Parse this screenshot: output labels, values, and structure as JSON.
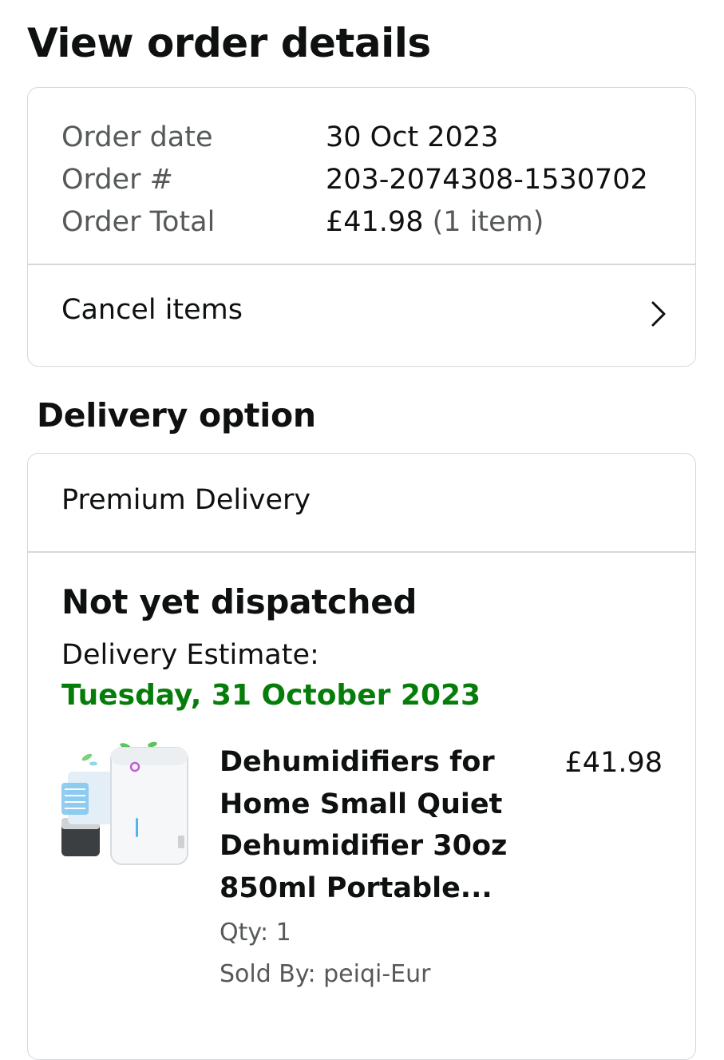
{
  "page": {
    "title": "View order details"
  },
  "order_summary": {
    "rows": [
      {
        "label": "Order date",
        "value": "30 Oct 2023"
      },
      {
        "label": "Order #",
        "value": "203-2074308-1530702"
      },
      {
        "label": "Order Total",
        "value": "£41.98",
        "extra": "(1 item)"
      }
    ],
    "cancel_label": "Cancel items"
  },
  "delivery": {
    "heading": "Delivery option",
    "option": "Premium Delivery",
    "status": "Not yet dispatched",
    "estimate_label": "Delivery Estimate:",
    "estimate_date": "Tuesday, 31 October 2023",
    "estimate_color": "#067d0b"
  },
  "item": {
    "name": "Dehumidifiers for Home Small Quiet Dehumidifier 30oz 850ml Portable...",
    "price": "£41.98",
    "qty": "Qty: 1",
    "sold_by": "Sold By: peiqi-Eur",
    "image_icon": "dehumidifier-product-image"
  },
  "icons": {
    "cancel_chevron": "chevron-right-icon"
  }
}
